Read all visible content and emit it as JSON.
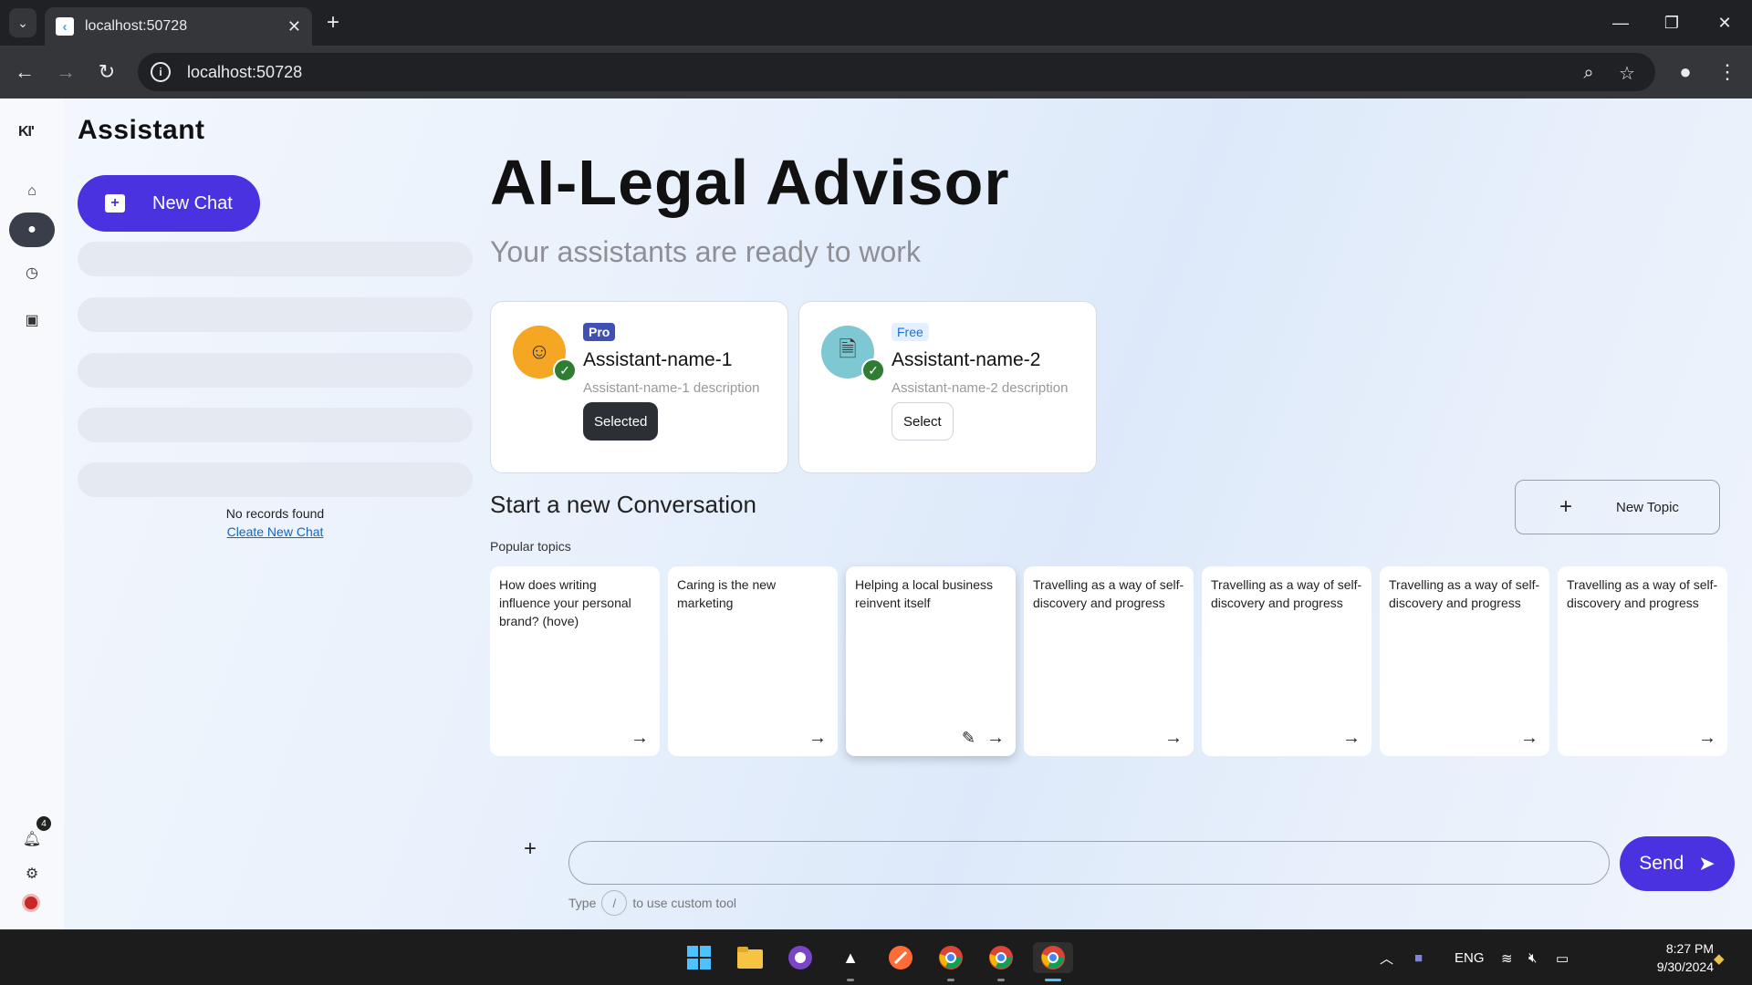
{
  "browser": {
    "tab_title": "localhost:50728",
    "url": "localhost:50728"
  },
  "sidebar": {
    "logo": "KI'",
    "notifications_count": "4"
  },
  "panel": {
    "title": "Assistant",
    "new_chat_label": "New Chat",
    "no_records": "No records found",
    "create_link": "Cleate New Chat"
  },
  "main": {
    "title": "AI-Legal Advisor",
    "subtitle": "Your assistants are ready to work",
    "assistants": [
      {
        "tier": "Pro",
        "name": "Assistant-name-1",
        "description": "Assistant-name-1 description",
        "button": "Selected",
        "selected": true,
        "icon": "robot-icon"
      },
      {
        "tier": "Free",
        "name": "Assistant-name-2",
        "description": "Assistant-name-2 description",
        "button": "Select",
        "selected": false,
        "icon": "document-icon"
      }
    ],
    "conversation_title": "Start a new Conversation",
    "new_topic_label": "New Topic",
    "popular_label": "Popular topics",
    "topics": [
      "How does writing influence your personal brand? (hove)",
      "Caring is the new marketing",
      "Helping a local business reinvent itself",
      "Travelling as a way of self-discovery and progress",
      "Travelling as a way of self-discovery and progress",
      "Travelling as a way of self-discovery and progress",
      "Travelling as a way of self-discovery and progress"
    ],
    "input_placeholder": "",
    "send_label": "Send",
    "hint_before": "Type",
    "hint_key": "/",
    "hint_after": "to use custom tool"
  },
  "taskbar": {
    "language": "ENG",
    "time": "8:27 PM",
    "date": "9/30/2024"
  },
  "colors": {
    "accent": "#4a32e0",
    "pro_badge": "#3f51b5",
    "check": "#2e7d32"
  }
}
